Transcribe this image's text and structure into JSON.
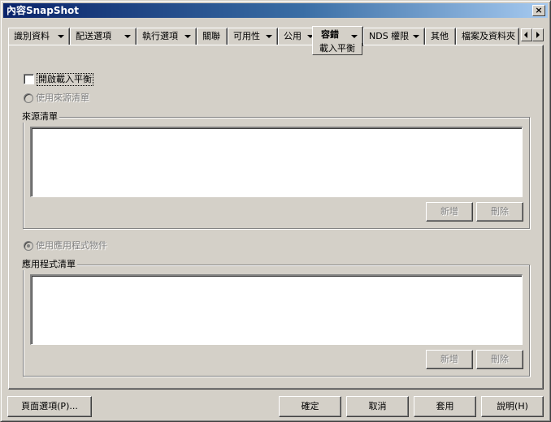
{
  "window": {
    "title": "內容SnapShot",
    "close_label": "×"
  },
  "tabs": [
    {
      "label": "識別資料"
    },
    {
      "label": "配送選項"
    },
    {
      "label": "執行選項"
    },
    {
      "label": "關聯"
    },
    {
      "label": "可用性"
    },
    {
      "label": "公用"
    },
    {
      "label": "容錯"
    },
    {
      "label": "NDS 權限"
    },
    {
      "label": "其他"
    },
    {
      "label": "檔案及資料夾"
    }
  ],
  "active_tab": {
    "label": "容錯",
    "subtab": "載入平衡"
  },
  "options": {
    "enable_load_balance": {
      "label": "開啟載入平衡",
      "checked": false
    },
    "use_source_list": {
      "label": "使用來源清單",
      "selected": false,
      "enabled": false
    },
    "use_app_objects": {
      "label": "使用應用程式物件",
      "selected": true,
      "enabled": false
    }
  },
  "source_list": {
    "legend": "來源清單",
    "items": [],
    "add_label": "新增",
    "delete_label": "刪除"
  },
  "app_list": {
    "legend": "應用程式清單",
    "items": [],
    "add_label": "新增",
    "delete_label": "刪除"
  },
  "footer": {
    "page_options_label": "頁面選項(P)...",
    "ok_label": "確定",
    "cancel_label": "取消",
    "apply_label": "套用",
    "help_label": "說明(H)"
  }
}
